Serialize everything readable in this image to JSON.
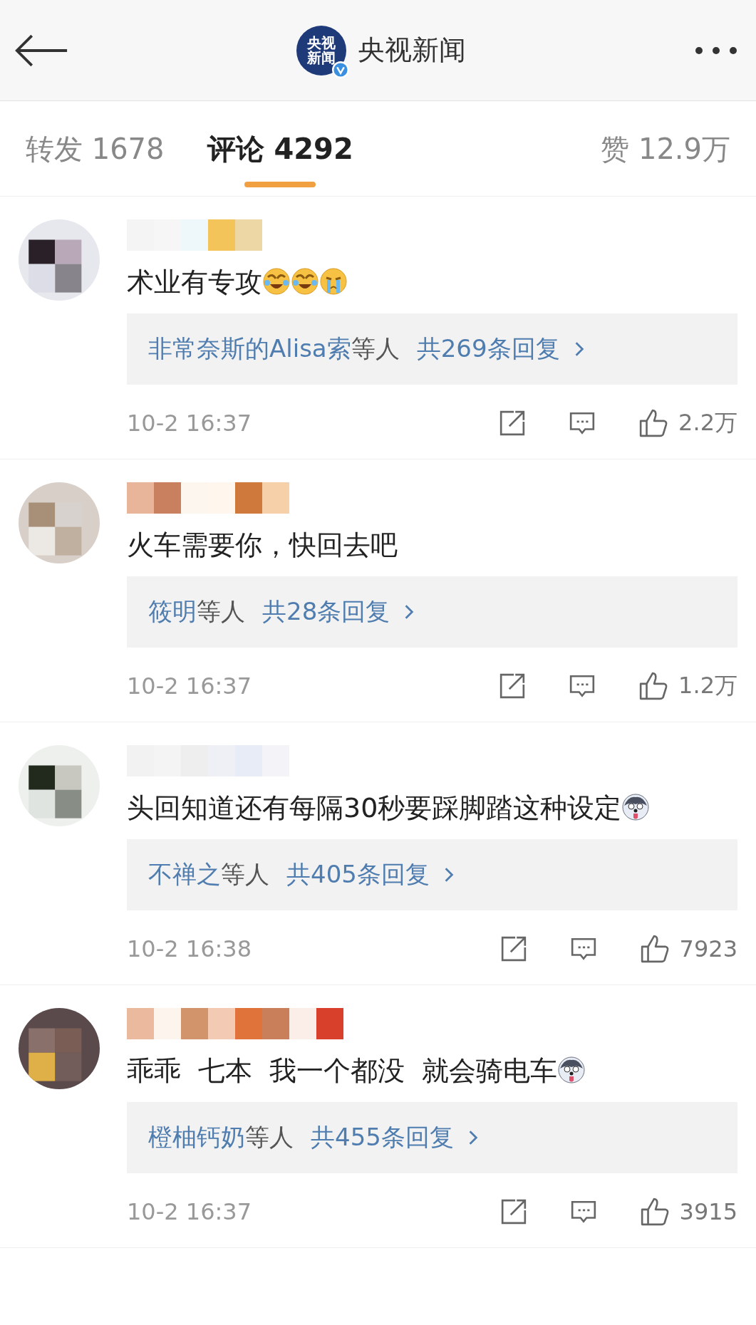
{
  "header": {
    "title": "央视新闻",
    "logo_text": [
      "央视",
      "新闻"
    ]
  },
  "tabs": [
    {
      "label": "转发 1678",
      "selected": false
    },
    {
      "label": "评论 4292",
      "selected": true
    },
    {
      "label": "赞 12.9万",
      "selected": false
    }
  ],
  "comments": [
    {
      "text": "术业有专攻",
      "emojis": [
        {
          "kind": "laugh"
        },
        {
          "kind": "laugh"
        },
        {
          "kind": "cry"
        }
      ],
      "reply_names": "非常奈斯的Alisa索",
      "reply_others": "等人",
      "reply_count": "共269条回复",
      "time": "10-2 16:37",
      "likes": "2.2万"
    },
    {
      "text": "火车需要你，快回去吧",
      "reply_names": "筱明",
      "reply_others": "等人",
      "reply_count": "共28条回复",
      "time": "10-2 16:37",
      "likes": "1.2万"
    },
    {
      "text": "头回知道还有每隔30秒要踩脚踏这种设定",
      "emojis": [
        {
          "kind": "dog"
        }
      ],
      "reply_names": "不禅之",
      "reply_others": "等人",
      "reply_count": "共405条回复",
      "time": "10-2 16:38",
      "likes": "7923"
    },
    {
      "text": "乖乖  七本  我一个都没  就会骑电车",
      "emojis": [
        {
          "kind": "dog"
        }
      ],
      "reply_names": "橙柚钙奶",
      "reply_others": "等人",
      "reply_count": "共455条回复",
      "time": "10-2 16:37",
      "likes": "3915"
    }
  ]
}
